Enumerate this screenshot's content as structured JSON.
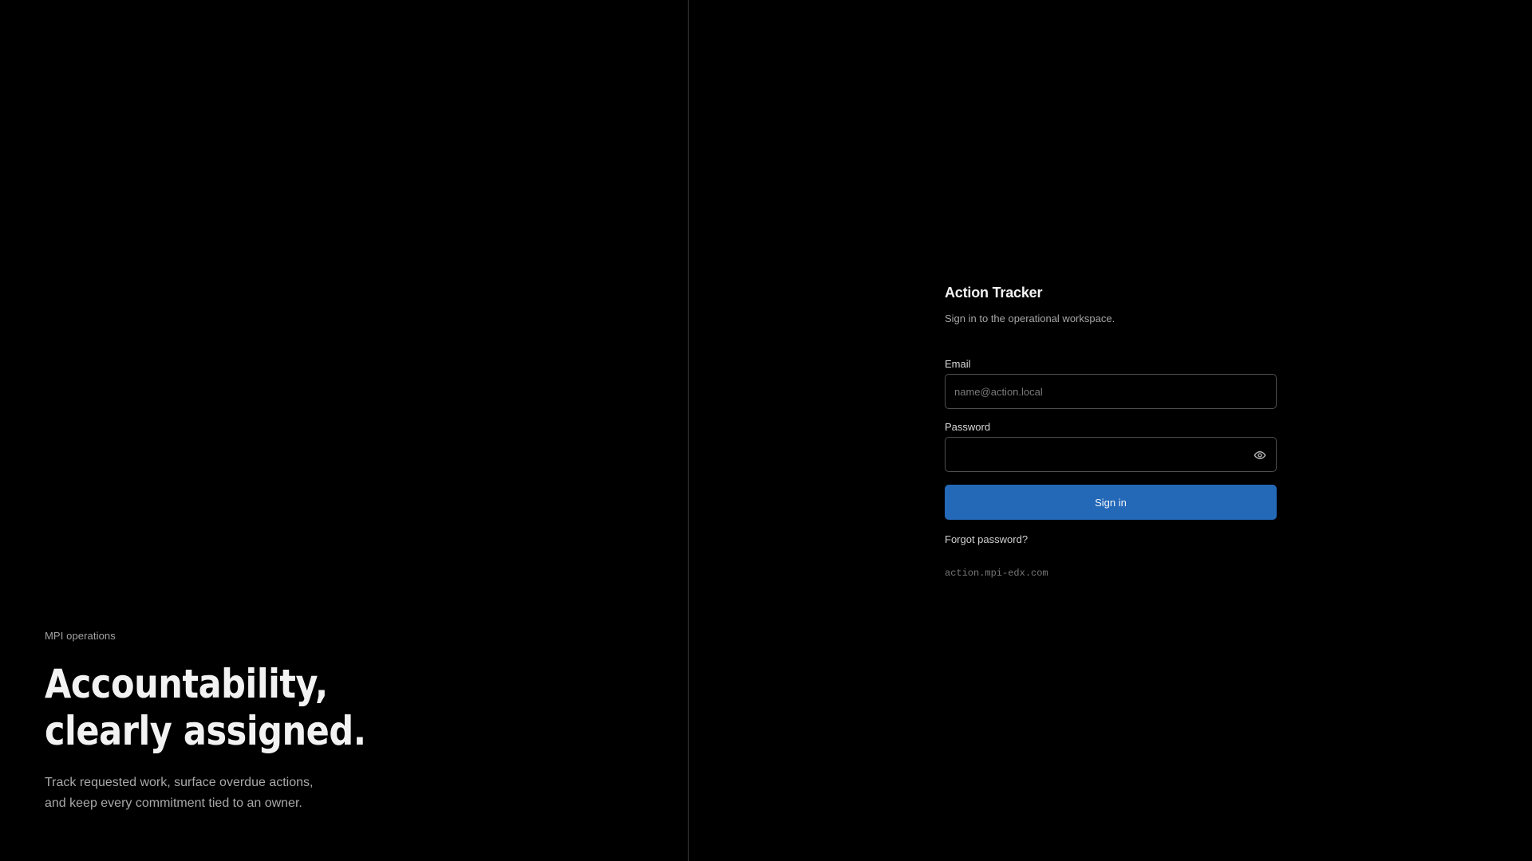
{
  "hero": {
    "eyebrow": "MPI operations",
    "headline_line1": "Accountability,",
    "headline_line2": "clearly assigned.",
    "description_line1": "Track requested work, surface overdue actions,",
    "description_line2": "and keep every commitment tied to an owner."
  },
  "auth": {
    "app_title": "Action Tracker",
    "subtitle": "Sign in to the operational workspace.",
    "email": {
      "label": "Email",
      "value": "",
      "placeholder": "name@action.local"
    },
    "password": {
      "label": "Password",
      "value": "",
      "placeholder": "",
      "toggle_icon": "eye-icon"
    },
    "signin_label": "Sign in",
    "forgot_label": "Forgot password?",
    "domain": "action.mpi-edx.com"
  },
  "colors": {
    "background": "#000000",
    "accent": "#2468b8",
    "divider": "#3a3a3a"
  }
}
